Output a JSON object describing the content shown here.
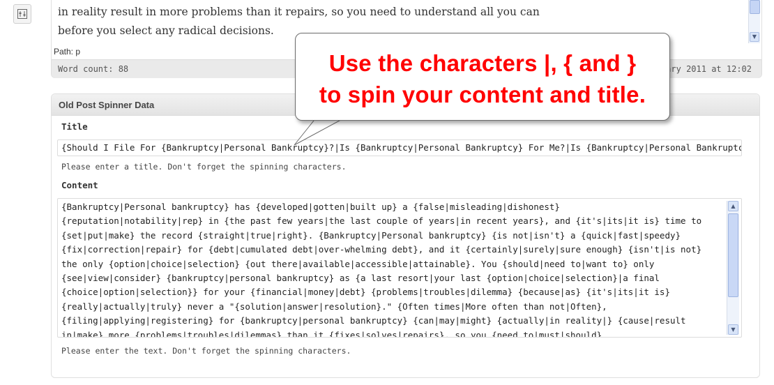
{
  "editor": {
    "lines": [
      "in reality result in more problems than it repairs, so you need to understand all you can",
      "before you select any radical decisions."
    ],
    "path": "Path: p",
    "word_count": "Word count: 88",
    "last_edited": "ebruary 2011 at 12:02"
  },
  "panel": {
    "title": "Old Post Spinner Data",
    "title_label": "Title",
    "title_value": "{Should I File For {Bankruptcy|Personal Bankruptcy}?|Is {Bankruptcy|Personal Bankruptcy} For Me?|Is {Bankruptcy|Personal Bankruptcy",
    "title_help": "Please enter a title. Don't forget the spinning characters.",
    "content_label": "Content",
    "content_lines": [
      "{Bankruptcy|Personal bankruptcy} has {developed|gotten|built up} a {false|misleading|dishonest}",
      "{reputation|notability|rep} in {the past few years|the last couple of years|in recent years}, and {it's|its|it is} time to",
      "{set|put|make} the record {straight|true|right}. {Bankruptcy|Personal bankruptcy} {is not|isn't} a {quick|fast|speedy}",
      "{fix|correction|repair} for {debt|cumulated debt|over-whelming debt}, and it {certainly|surely|sure enough} {isn't|is not}",
      "the only {option|choice|selection} {out there|available|accessible|attainable}. You {should|need to|want to} only",
      "{see|view|consider} {bankruptcy|personal bankruptcy} as {a last resort|your last {option|choice|selection}|a final",
      "{choice|option|selection}} for your {financial|money|debt} {problems|troubles|dilemma} {because|as} {it's|its|it is}",
      "{really|actually|truly} never a \"{solution|answer|resolution}.\" {Often times|More often than not|Often},",
      "{filing|applying|registering} for {bankruptcy|personal bankruptcy} {can|may|might} {actually|in reality|} {cause|result",
      "in|make} more {problems|troubles|dilemmas} than it {fixes|solves|repairs}, so you {need to|must|should}"
    ],
    "content_help": "Please enter the text. Don't forget the spinning characters."
  },
  "callout": {
    "line1": "Use the characters |, { and }",
    "line2": "to spin your content and title."
  },
  "colors": {
    "callout_text": "#ff0000",
    "panel_header": "#e3e3e3",
    "status_bar": "#eaeaea"
  },
  "icons": {
    "rail": "settings-sliders-icon",
    "scroll_up": "arrow-up-icon",
    "scroll_down": "arrow-down-icon"
  }
}
